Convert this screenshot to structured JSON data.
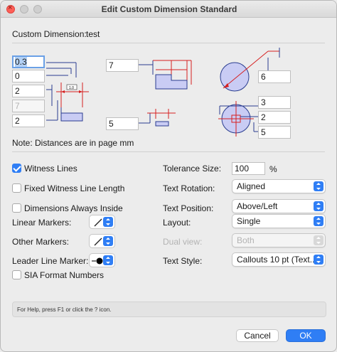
{
  "window": {
    "title": "Edit Custom Dimension Standard"
  },
  "header": {
    "custom_dimension_label": "Custom Dimension:",
    "custom_dimension_value": "test"
  },
  "diagram_fields": {
    "f1": "0.3",
    "f2": "0",
    "f3": "2",
    "f4": "7",
    "f5": "2",
    "f6": "7",
    "f7": "5",
    "f8": "6",
    "f9": "3",
    "f10": "2",
    "f11": "5",
    "tiny_label": "1.0"
  },
  "note": "Note: Distances are in page mm",
  "options": {
    "witness_lines": {
      "label": "Witness Lines",
      "checked": true
    },
    "fixed_witness": {
      "label": "Fixed Witness Line Length",
      "checked": false
    },
    "always_inside": {
      "label": "Dimensions Always Inside",
      "checked": false
    },
    "sia_format": {
      "label": "SIA Format Numbers",
      "checked": false
    }
  },
  "markers": {
    "linear_label": "Linear Markers:",
    "other_label": "Other Markers:",
    "leader_label": "Leader Line Marker:"
  },
  "right_panel": {
    "tolerance_label": "Tolerance Size:",
    "tolerance_value": "100",
    "tolerance_unit": "%",
    "text_rotation_label": "Text Rotation:",
    "text_rotation_value": "Aligned",
    "text_position_label": "Text Position:",
    "text_position_value": "Above/Left",
    "layout_label": "Layout:",
    "layout_value": "Single",
    "dual_view_label": "Dual view:",
    "dual_view_value": "Both",
    "text_style_label": "Text Style:",
    "text_style_value": "Callouts 10 pt (Text..."
  },
  "help_text": "For Help, press F1 or click the ? icon.",
  "buttons": {
    "cancel": "Cancel",
    "ok": "OK"
  },
  "colors": {
    "accent": "#2f7ef5",
    "diagram_red": "#d62020",
    "diagram_blue": "#2a3d8f",
    "diagram_fill": "#c9ccf4"
  }
}
